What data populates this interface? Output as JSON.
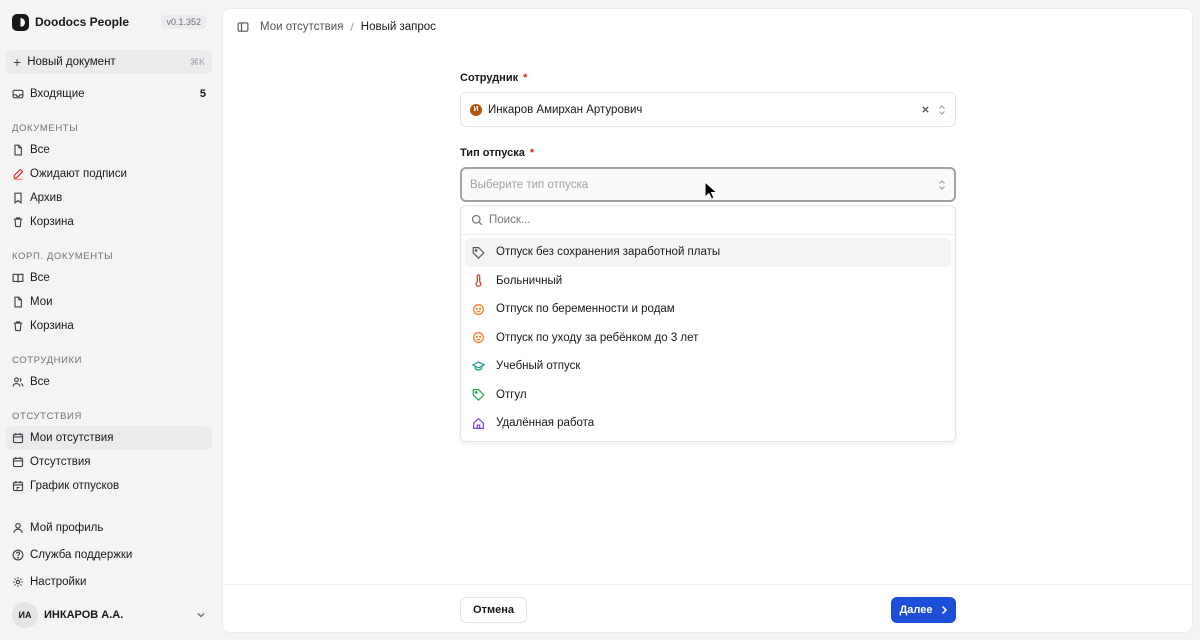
{
  "app": {
    "name": "Doodocs People",
    "version": "v0.1.352"
  },
  "sidebar": {
    "new_doc": {
      "label": "Новый документ",
      "shortcut": "⌘K"
    },
    "inbox": {
      "label": "Входящие",
      "count": "5"
    },
    "sections": [
      {
        "title": "ДОКУМЕНТЫ",
        "items": [
          "Все",
          "Ожидают подписи",
          "Архив",
          "Корзина"
        ]
      },
      {
        "title": "КОРП. ДОКУМЕНТЫ",
        "items": [
          "Все",
          "Мои",
          "Корзина"
        ]
      },
      {
        "title": "СОТРУДНИКИ",
        "items": [
          "Все"
        ]
      },
      {
        "title": "ОТСУТСТВИЯ",
        "items": [
          "Мои отсутствия",
          "Отсутствия",
          "График отпусков"
        ]
      }
    ],
    "bottom_items": [
      "Мой профиль",
      "Служба поддержки",
      "Настройки"
    ],
    "user": {
      "initials": "ИА",
      "name": "ИНКАРОВ А.А."
    }
  },
  "breadcrumb": {
    "parent": "Мои отсутствия",
    "separator": "/",
    "current": "Новый запрос"
  },
  "form": {
    "employee": {
      "label": "Сотрудник",
      "required_mark": "*",
      "avatar_letter": "И",
      "value": "Инкаров Амирхан Артурович"
    },
    "leave_type": {
      "label": "Тип отпуска",
      "required_mark": "*",
      "placeholder": "Выберите тип отпуска"
    }
  },
  "dropdown": {
    "search_placeholder": "Поиск...",
    "options": [
      {
        "label": "Отпуск без сохранения заработной платы",
        "icon": "tag-icon",
        "color": "#52525b"
      },
      {
        "label": "Больничный",
        "icon": "thermometer-icon",
        "color": "#dc2626"
      },
      {
        "label": "Отпуск по беременности и родам",
        "icon": "baby-icon",
        "color": "#f97316"
      },
      {
        "label": "Отпуск по уходу за ребёнком до 3 лет",
        "icon": "baby-icon",
        "color": "#f97316"
      },
      {
        "label": "Учебный отпуск",
        "icon": "graduation-cap-icon",
        "color": "#0d9488"
      },
      {
        "label": "Отгул",
        "icon": "tag-icon",
        "color": "#16a34a"
      },
      {
        "label": "Удалённая работа",
        "icon": "home-icon",
        "color": "#7c3aed"
      }
    ]
  },
  "footer": {
    "cancel_label": "Отмена",
    "next_label": "Далее"
  },
  "colors": {
    "primary": "#1d4ed8",
    "required": "#dc2626",
    "sidebar_bg": "#f4f4f5"
  }
}
